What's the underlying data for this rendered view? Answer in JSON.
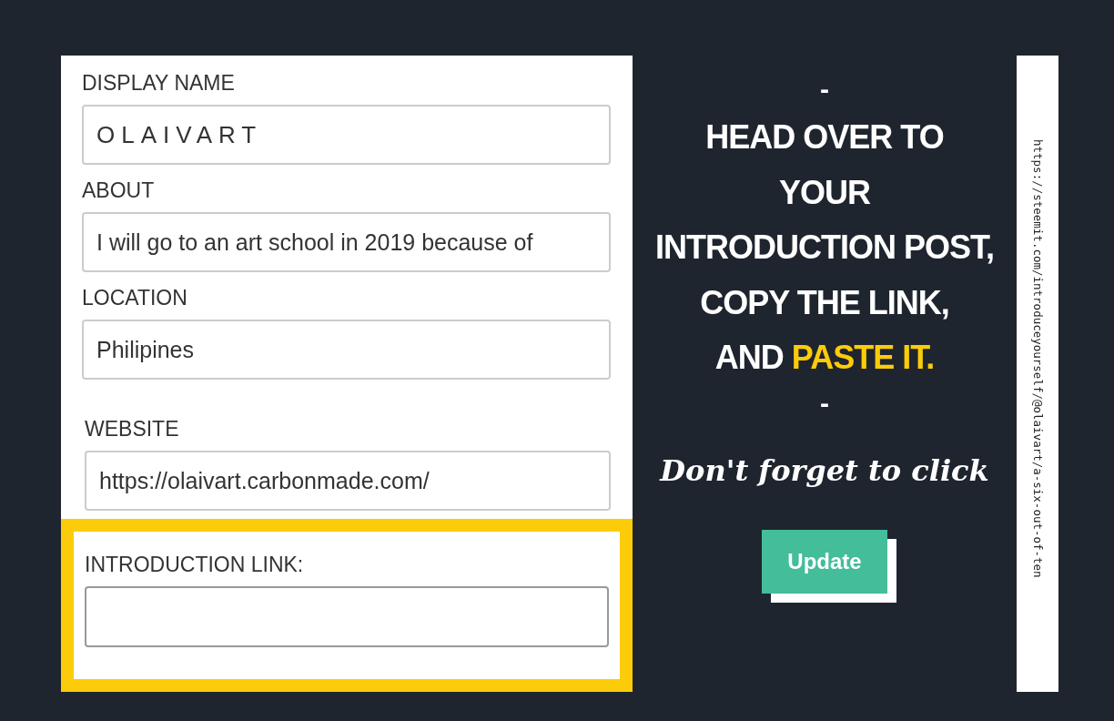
{
  "form": {
    "fields": [
      {
        "label": "DISPLAY NAME",
        "value": "OLAIVART",
        "kind": "spaced"
      },
      {
        "label": "ABOUT",
        "value": "I will go to an art school in 2019 because of",
        "kind": "plain"
      },
      {
        "label": "LOCATION",
        "value": "Philipines",
        "kind": "plain"
      },
      {
        "label": "WEBSITE",
        "value": "https://olaivart.carbonmade.com/",
        "kind": "plain"
      }
    ],
    "introduction": {
      "label": "INTRODUCTION LINK:",
      "highlighted": true
    }
  },
  "instructions": {
    "top_dash": "-",
    "headline": [
      "HEAD OVER TO",
      "YOUR",
      "INTRODUCTION POST,",
      "COPY THE LINK,",
      "AND **PASTE IT.**"
    ],
    "bottom_dash": "-",
    "note": "Don't forget to click",
    "button": "Update"
  },
  "side_strip": {
    "url": "https://steemit.com/introduceyourself/@olaivart/a-six-out-of-ten"
  }
}
